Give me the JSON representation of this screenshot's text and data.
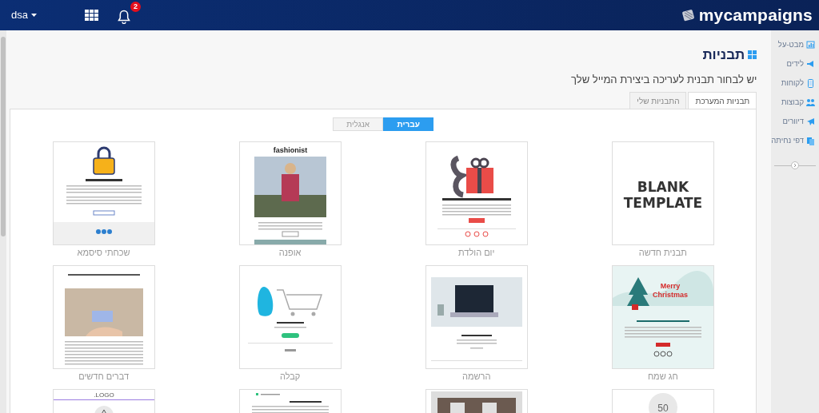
{
  "header": {
    "brand": "mycampaigns",
    "user": "dsa",
    "notifications_count": "2"
  },
  "sidebar": {
    "items": [
      {
        "label": "מבט-על"
      },
      {
        "label": "לידים"
      },
      {
        "label": "לקוחות"
      },
      {
        "label": "קבוצות"
      },
      {
        "label": "דיוורים"
      },
      {
        "label": "דפי נחיתה"
      }
    ]
  },
  "page": {
    "title": "תבניות",
    "subtitle": "יש לבחור תבנית לעריכה ביצירת המייל שלך"
  },
  "tabs": [
    {
      "label": "תבניות המערכת",
      "selected": true
    },
    {
      "label": "התבניות שלי",
      "selected": false
    }
  ],
  "language_toggle": [
    {
      "label": "עברית",
      "selected": true
    },
    {
      "label": "אנגלית",
      "selected": false
    }
  ],
  "templates": [
    {
      "kind": "blank",
      "heading": "BLANK TEMPLATE",
      "label": "תבנית חדשה"
    },
    {
      "kind": "gift",
      "label": "יום הולדת"
    },
    {
      "kind": "fashion",
      "heading": "fashionist",
      "label": "אופנה"
    },
    {
      "kind": "lock",
      "label": "שכחתי סיסמא"
    },
    {
      "kind": "christmas",
      "heading": "Merry Christmas",
      "label": "חג שמח"
    },
    {
      "kind": "laptop",
      "label": "הרשמה"
    },
    {
      "kind": "cart",
      "label": "קבלה"
    },
    {
      "kind": "news",
      "label": "דברים חדשים"
    },
    {
      "kind": "discount",
      "heading": "50"
    },
    {
      "kind": "group"
    },
    {
      "kind": "thanks"
    },
    {
      "kind": "warning",
      "heading": "LOGO."
    }
  ]
}
